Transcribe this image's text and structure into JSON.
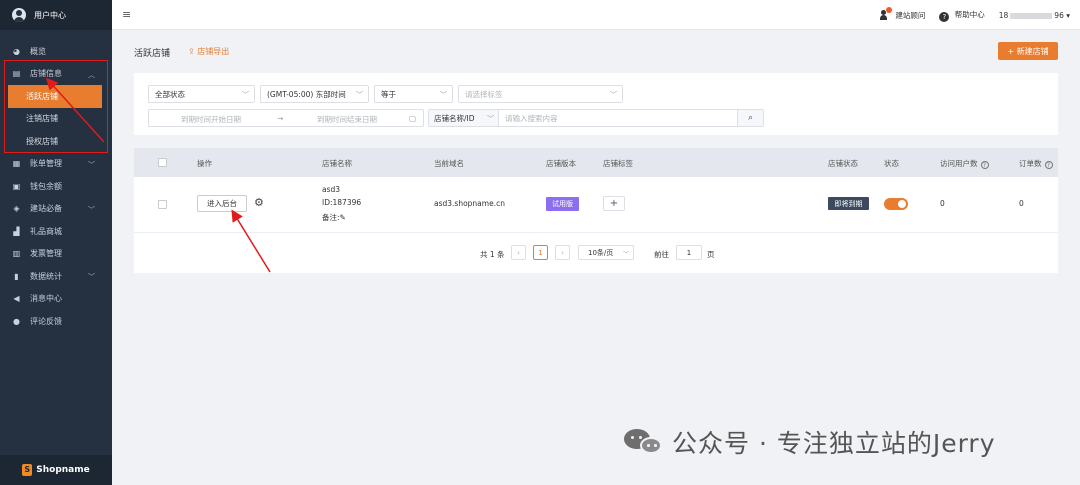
{
  "sidebar": {
    "header_title": "用户中心",
    "items": [
      {
        "label": "概览",
        "icon": "dashboard-icon"
      },
      {
        "label": "店铺信息",
        "icon": "store-icon",
        "expanded": true
      },
      {
        "label": "账单管理",
        "icon": "bill-icon",
        "has_submenu": true
      },
      {
        "label": "钱包余额",
        "icon": "wallet-icon"
      },
      {
        "label": "建站必备",
        "icon": "box-icon",
        "has_submenu": true
      },
      {
        "label": "礼品商城",
        "icon": "gift-icon"
      },
      {
        "label": "发票管理",
        "icon": "invoice-icon"
      },
      {
        "label": "数据统计",
        "icon": "chart-icon",
        "has_submenu": true
      },
      {
        "label": "消息中心",
        "icon": "megaphone-icon"
      },
      {
        "label": "评论反馈",
        "icon": "comment-icon"
      }
    ],
    "store_submenu": [
      {
        "label": "活跃店铺",
        "active": true
      },
      {
        "label": "注销店铺"
      },
      {
        "label": "授权店铺"
      }
    ],
    "brand": "Shopname"
  },
  "topbar": {
    "consultant": "建站顾问",
    "help": "帮助中心",
    "phone_prefix": "18",
    "phone_suffix": "96"
  },
  "page": {
    "title": "活跃店铺",
    "export_label": "店铺导出",
    "new_store_label": "+ 新建店铺"
  },
  "filters": {
    "status": "全部状态",
    "timezone": "(GMT-05:00) 东部时间",
    "operator": "等于",
    "tag_placeholder": "请选择标签",
    "date_start_placeholder": "到期时间开始日期",
    "date_end_placeholder": "到期时间结束日期",
    "search_field": "店铺名称/ID",
    "search_placeholder": "请输入搜索内容"
  },
  "table": {
    "headers": {
      "action": "操作",
      "store_name": "店铺名称",
      "domain": "当前域名",
      "version": "店铺版本",
      "tags": "店铺标签",
      "store_status": "店铺状态",
      "state": "状态",
      "visitors": "访问用户数",
      "orders": "订单数"
    },
    "rows": [
      {
        "action_label": "进入后台",
        "name": "asd3",
        "id": "ID:187396",
        "note": "备注:",
        "domain": "asd3.shopname.cn",
        "version": "试用版",
        "store_status": "即将到期",
        "enabled": true,
        "visitors": "0",
        "orders": "0"
      }
    ]
  },
  "pagination": {
    "total": "共 1 条",
    "current_page": "1",
    "page_size": "10条/页",
    "goto_label": "前往",
    "goto_value": "1",
    "page_unit": "页"
  },
  "watermark": "公众号 · 专注独立站的Jerry",
  "colors": {
    "accent": "#e87d30",
    "sidebar_bg": "#253041",
    "trial_badge": "#8c6ff0",
    "expire_badge": "#3b4a5e",
    "annotation_red": "#e01b1b"
  }
}
